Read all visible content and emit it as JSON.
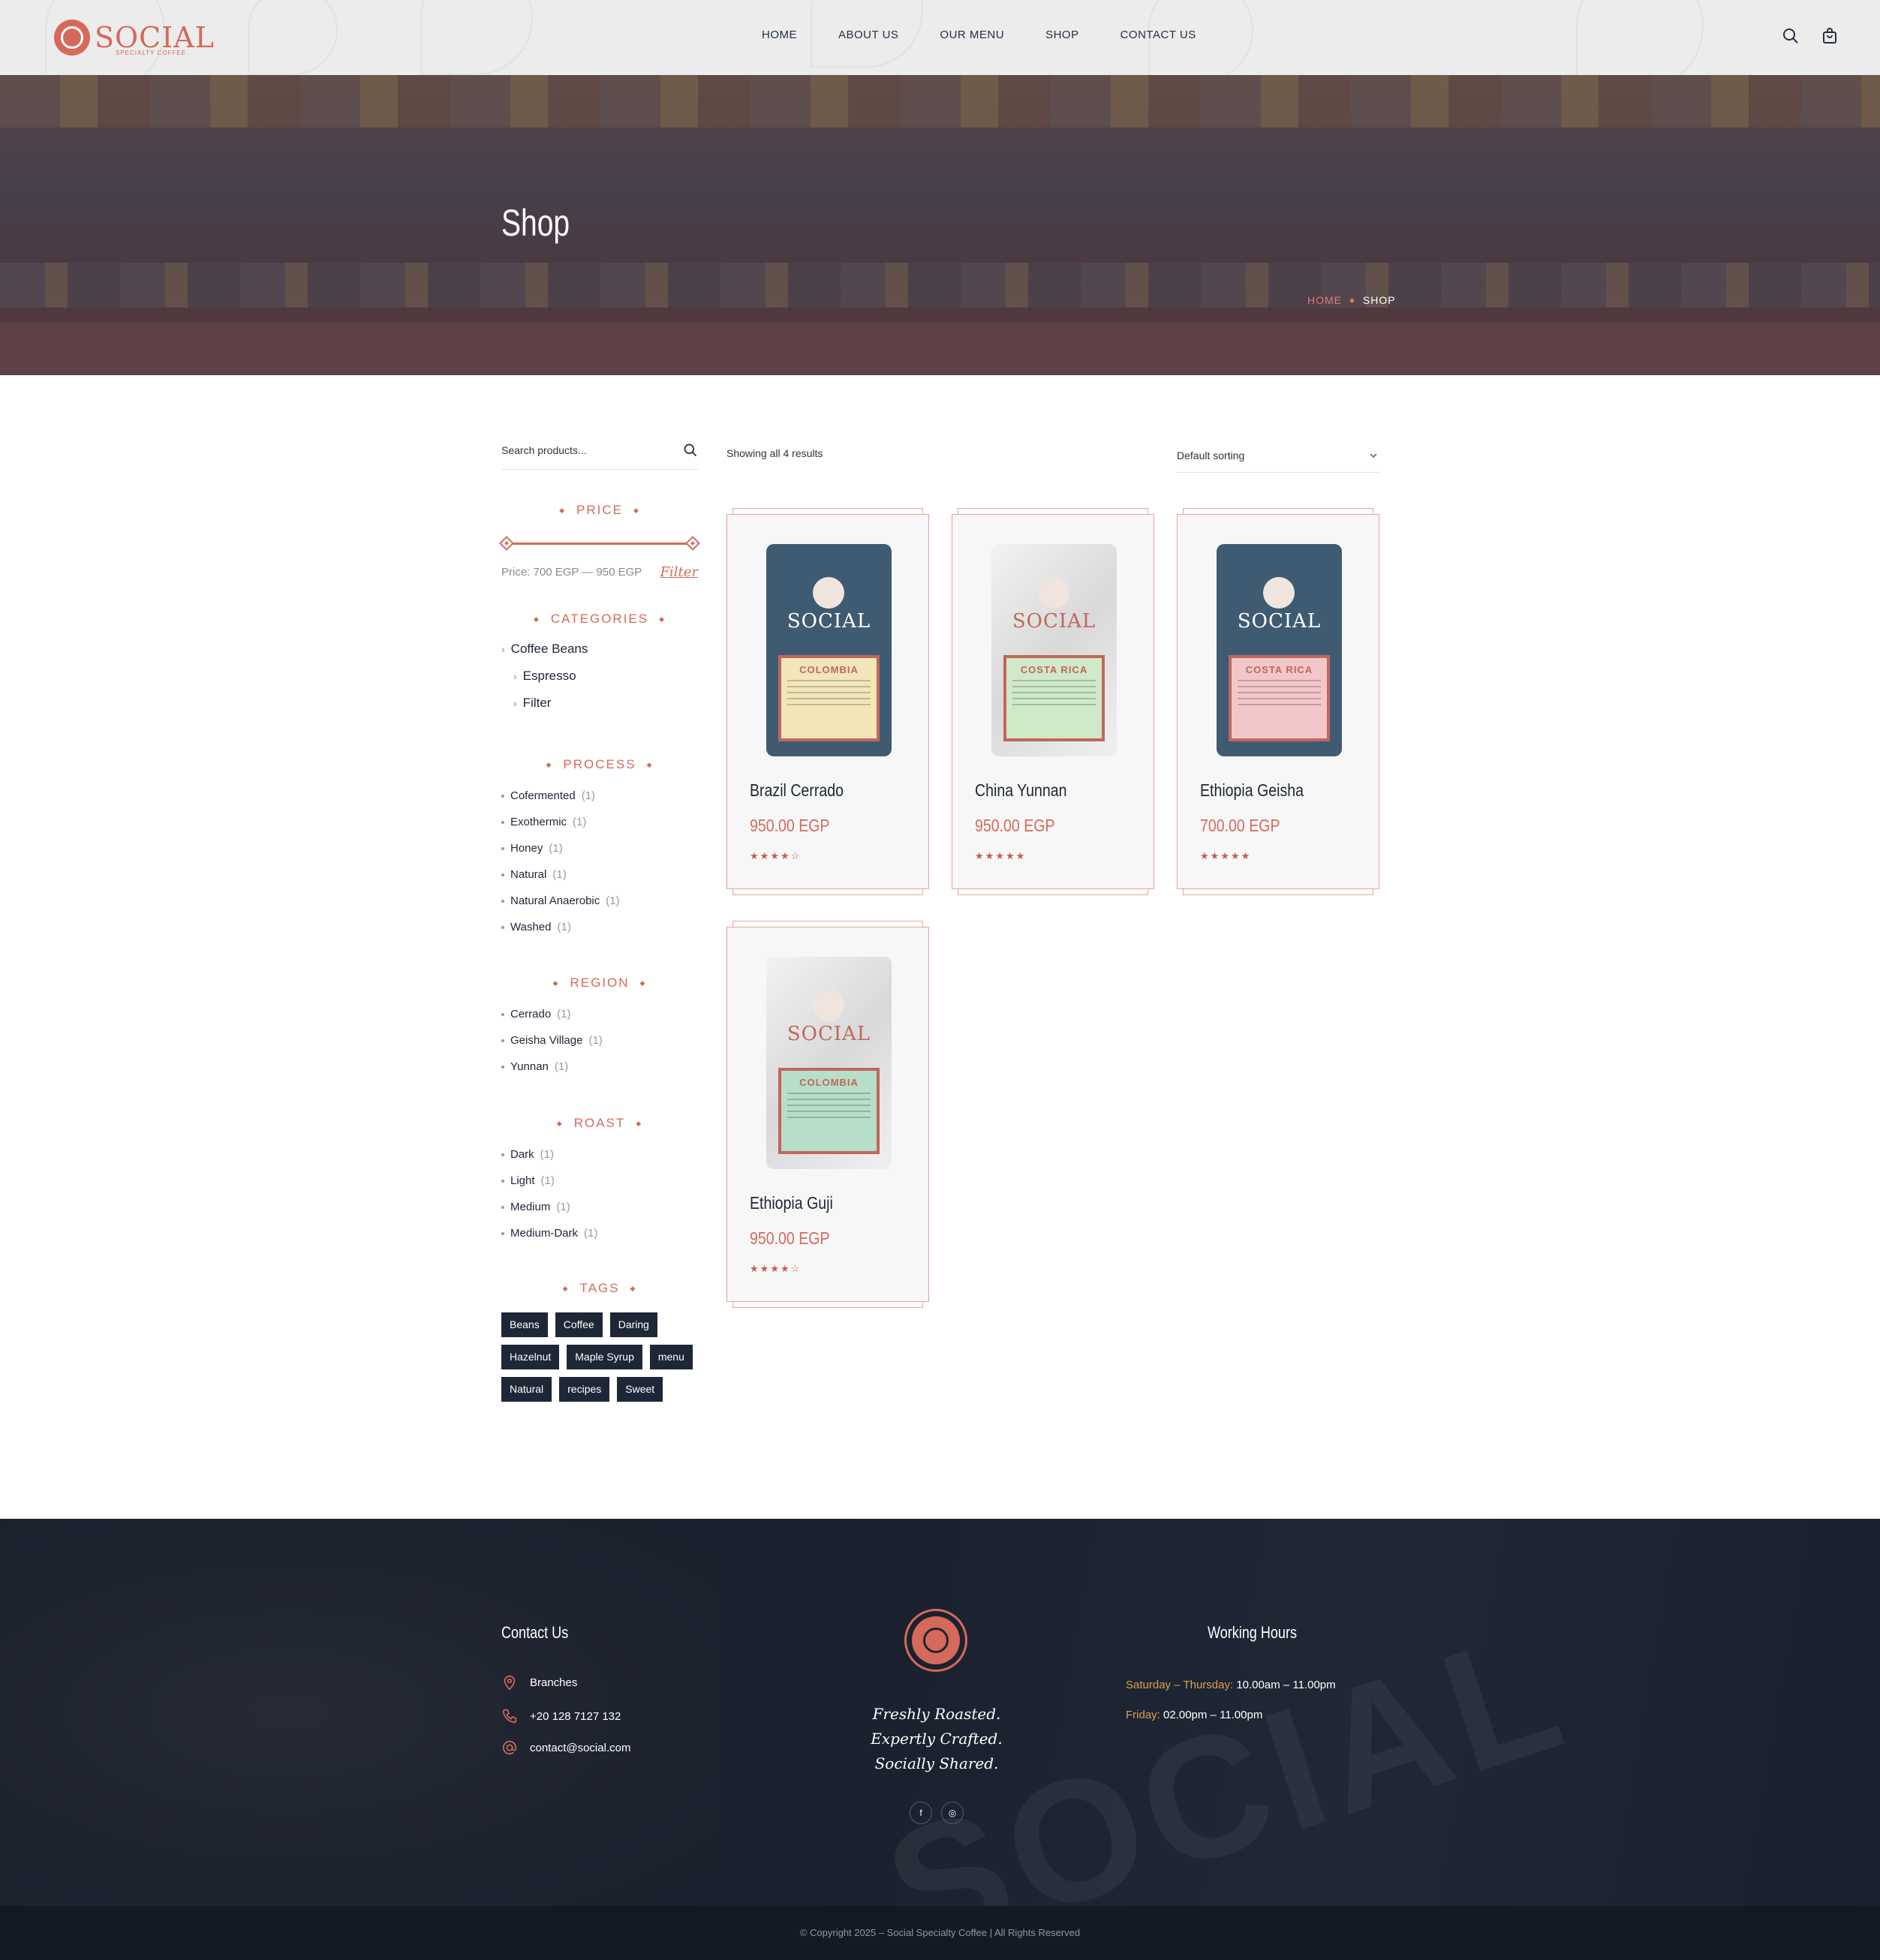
{
  "header": {
    "logo_text": "SOCIAL",
    "logo_sub": "SPECIALTY COFFEE",
    "nav": [
      {
        "label": "HOME"
      },
      {
        "label": "ABOUT US"
      },
      {
        "label": "OUR MENU"
      },
      {
        "label": "SHOP"
      },
      {
        "label": "CONTACT US"
      }
    ],
    "icons": [
      "search-icon",
      "cart-icon"
    ]
  },
  "hero": {
    "title": "Shop",
    "breadcrumb": {
      "home": "HOME",
      "current": "SHOP"
    }
  },
  "sidebar": {
    "search_placeholder": "Search products...",
    "price": {
      "title": "PRICE",
      "text": "Price: 700 EGP — 950 EGP",
      "filter_label": "Filter",
      "min": 700,
      "max": 950
    },
    "categories": {
      "title": "CATEGORIES",
      "items": [
        {
          "label": "Coffee Beans"
        },
        {
          "label": "Espresso"
        },
        {
          "label": "Filter"
        }
      ]
    },
    "process": {
      "title": "PROCESS",
      "items": [
        {
          "label": "Cofermented",
          "count": "(1)"
        },
        {
          "label": "Exothermic",
          "count": "(1)"
        },
        {
          "label": "Honey",
          "count": "(1)"
        },
        {
          "label": "Natural",
          "count": "(1)"
        },
        {
          "label": "Natural Anaerobic",
          "count": "(1)"
        },
        {
          "label": "Washed",
          "count": "(1)"
        }
      ]
    },
    "region": {
      "title": "REGION",
      "items": [
        {
          "label": "Cerrado",
          "count": "(1)"
        },
        {
          "label": "Geisha Village",
          "count": "(1)"
        },
        {
          "label": "Yunnan",
          "count": "(1)"
        }
      ]
    },
    "roast": {
      "title": "ROAST",
      "items": [
        {
          "label": "Dark",
          "count": "(1)"
        },
        {
          "label": "Light",
          "count": "(1)"
        },
        {
          "label": "Medium",
          "count": "(1)"
        },
        {
          "label": "Medium-Dark",
          "count": "(1)"
        }
      ]
    },
    "tags": {
      "title": "TAGS",
      "items": [
        "Beans",
        "Coffee",
        "Daring",
        "Hazelnut",
        "Maple Syrup",
        "menu",
        "Natural",
        "recipes",
        "Sweet"
      ]
    }
  },
  "shop": {
    "results_text": "Showing all 4 results",
    "sorting": "Default sorting",
    "products": [
      {
        "name": "Brazil Cerrado",
        "price": "950.00 EGP",
        "rating": 4,
        "bag_color": "#3e5b72",
        "label_color": "#f2e6b8",
        "label_text": "COLOMBIA"
      },
      {
        "name": "China Yunnan",
        "price": "950.00 EGP",
        "rating": 5,
        "bag_color": "#e8e8e8",
        "label_color": "#cfe9c9",
        "label_text": "COSTA RICA"
      },
      {
        "name": "Ethiopia Geisha",
        "price": "700.00 EGP",
        "rating": 5,
        "bag_color": "#3e5b72",
        "label_color": "#f3c7c9",
        "label_text": "COSTA RICA"
      },
      {
        "name": "Ethiopia Guji",
        "price": "950.00 EGP",
        "rating": 4,
        "bag_color": "#e8e8e8",
        "label_color": "#b7dec8",
        "label_text": "COLOMBIA"
      }
    ]
  },
  "footer": {
    "contact": {
      "title": "Contact Us",
      "branches": "Branches",
      "phone": "+20 128 7127 132",
      "email": "contact@social.com"
    },
    "tagline": [
      "Freshly Roasted.",
      "Expertly Crafted.",
      "Socially Shared."
    ],
    "social": [
      "facebook-icon",
      "instagram-icon"
    ],
    "hours": {
      "title": "Working Hours",
      "rows": [
        {
          "days": "Saturday – Thursday:",
          "time": "10.00am – 11.00pm"
        },
        {
          "days": "Friday:",
          "time": "02.00pm – 11.00pm"
        }
      ]
    },
    "copyright": "© Copyright 2025 – Social Specialty Coffee | All Rights Reserved"
  },
  "colors": {
    "accent": "#d5695c",
    "navy": "#1e2736",
    "footer": "#1e2633"
  }
}
